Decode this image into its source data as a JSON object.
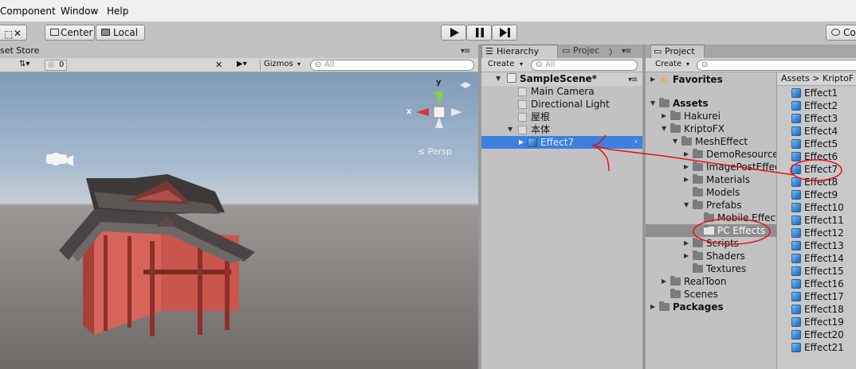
{
  "menu": [
    "Component",
    "Window",
    "Help"
  ],
  "toolbar": {
    "pivot_label": "Center",
    "space_label": "Local",
    "collab_label": "Co"
  },
  "scene": {
    "tab_title": "set Store",
    "shading_count": "0",
    "gizmos_label": "Gizmos",
    "search_placeholder": "All",
    "axis_y": "y",
    "axis_x": "x",
    "persp_label": "Persp"
  },
  "hierarchy": {
    "tab_title": "Hierarchy",
    "tab2_title": "Projec",
    "create_label": "Create",
    "search_placeholder": "All",
    "scene_name": "SampleScene*",
    "items": [
      {
        "label": "Main Camera"
      },
      {
        "label": "Directional Light"
      },
      {
        "label": "屋根"
      },
      {
        "label": "本体"
      },
      {
        "label": "Effect7"
      }
    ]
  },
  "project": {
    "tab_title": "Project",
    "create_label": "Create",
    "tree": [
      {
        "label": "Favorites"
      },
      {
        "label": "Assets"
      },
      {
        "label": "Hakurei"
      },
      {
        "label": "KriptoFX"
      },
      {
        "label": "MeshEffect"
      },
      {
        "label": "DemoResource"
      },
      {
        "label": "ImagePostEffec"
      },
      {
        "label": "Materials"
      },
      {
        "label": "Models"
      },
      {
        "label": "Prefabs"
      },
      {
        "label": "Mobile Effects"
      },
      {
        "label": "PC Effects"
      },
      {
        "label": "Scripts"
      },
      {
        "label": "Shaders"
      },
      {
        "label": "Textures"
      },
      {
        "label": "RealToon"
      },
      {
        "label": "Scenes"
      },
      {
        "label": "Packages"
      }
    ],
    "breadcrumb": "Assets > KriptoF",
    "assets": [
      "Effect1",
      "Effect2",
      "Effect3",
      "Effect4",
      "Effect5",
      "Effect6",
      "Effect7",
      "Effect8",
      "Effect9",
      "Effect10",
      "Effect11",
      "Effect12",
      "Effect13",
      "Effect14",
      "Effect15",
      "Effect16",
      "Effect17",
      "Effect18",
      "Effect19",
      "Effect20",
      "Effect21"
    ]
  },
  "colors": {
    "selection": "#3d80df",
    "annotation": "#e8101a",
    "panel": "#c2c2c2"
  }
}
